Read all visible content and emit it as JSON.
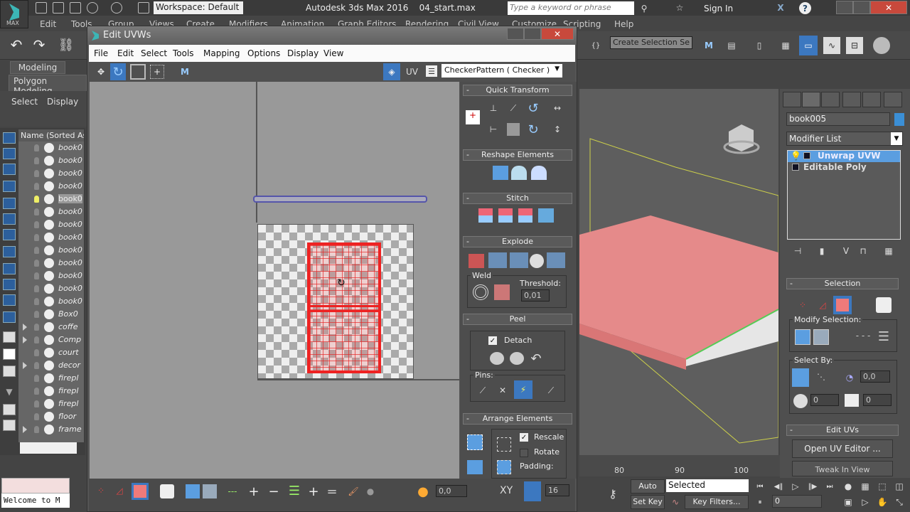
{
  "app": {
    "logo_text": "MAX",
    "workspace": "Workspace: Default",
    "title": "Autodesk 3ds Max 2016",
    "file": "04_start.max",
    "search_placeholder": "Type a keyword or phrase",
    "sign_in": "Sign In",
    "menus": [
      "Edit",
      "Tools",
      "Group",
      "Views",
      "Create",
      "Modifiers",
      "Animation",
      "Graph Editors",
      "Rendering",
      "Civil View",
      "Customize",
      "Scripting",
      "Help"
    ],
    "selection_set": "Create Selection Se"
  },
  "ribbon": {
    "tabs": [
      "Modeling",
      "Polygon Modeling"
    ],
    "sub": [
      "Select",
      "Display"
    ]
  },
  "explorer": {
    "header": "Name (Sorted Asc",
    "rows": [
      {
        "name": "book0",
        "expand": false,
        "light": false
      },
      {
        "name": "book0",
        "expand": false,
        "light": false
      },
      {
        "name": "book0",
        "expand": false,
        "light": false
      },
      {
        "name": "book0",
        "expand": false,
        "light": false
      },
      {
        "name": "book0",
        "expand": false,
        "light": true,
        "selected": true
      },
      {
        "name": "book0",
        "expand": false,
        "light": false
      },
      {
        "name": "book0",
        "expand": false,
        "light": false
      },
      {
        "name": "book0",
        "expand": false,
        "light": false
      },
      {
        "name": "book0",
        "expand": false,
        "light": false
      },
      {
        "name": "book0",
        "expand": false,
        "light": false
      },
      {
        "name": "book0",
        "expand": false,
        "light": false
      },
      {
        "name": "book0",
        "expand": false,
        "light": false
      },
      {
        "name": "book0",
        "expand": false,
        "light": false
      },
      {
        "name": "Box0",
        "expand": false,
        "light": false
      },
      {
        "name": "coffe",
        "expand": true,
        "light": false
      },
      {
        "name": "Comp",
        "expand": true,
        "light": false
      },
      {
        "name": "court",
        "expand": false,
        "light": false
      },
      {
        "name": "decor",
        "expand": true,
        "light": false
      },
      {
        "name": "firepl",
        "expand": false,
        "light": false
      },
      {
        "name": "firepl",
        "expand": false,
        "light": false
      },
      {
        "name": "firepl",
        "expand": false,
        "light": false
      },
      {
        "name": "floor",
        "expand": false,
        "light": false
      },
      {
        "name": "frame",
        "expand": true,
        "light": false
      }
    ],
    "welcome": "Welcome to M"
  },
  "uvw": {
    "title": "Edit UVWs",
    "menus": [
      "File",
      "Edit",
      "Select",
      "Tools",
      "Mapping",
      "Options",
      "Display",
      "View"
    ],
    "uv_label": "UV",
    "texture": "CheckerPattern  ( Checker )",
    "rollouts": {
      "quick_transform": "Quick Transform",
      "reshape": "Reshape Elements",
      "stitch": "Stitch",
      "explode": "Explode",
      "weld": "Weld",
      "threshold_label": "Threshold:",
      "threshold": "0,01",
      "peel": "Peel",
      "detach": "Detach",
      "detach_checked": true,
      "pins": "Pins:",
      "arrange": "Arrange Elements",
      "rescale": "Rescale",
      "rescale_checked": true,
      "rotate": "Rotate",
      "rotate_checked": false,
      "padding": "Padding:"
    },
    "bottom": {
      "soft_value": "0,0",
      "xy": "XY",
      "grid_value": "16"
    }
  },
  "command_panel": {
    "object_name": "book005",
    "object_color": "#3b8fd6",
    "modifier_list": "Modifier List",
    "stack": [
      "Unwrap UVW",
      "Editable Poly"
    ],
    "selection": "Selection",
    "modify_selection": "Modify Selection:",
    "select_by": "Select By:",
    "angle": "0,0",
    "spin1": "0",
    "spin2": "0",
    "edit_uvs": "Edit UVs",
    "open_uv_editor": "Open UV Editor ...",
    "tweak": "Tweak In View"
  },
  "timeline": {
    "ticks": [
      "80",
      "90",
      "100"
    ]
  },
  "anim": {
    "auto_key": "Auto Key",
    "set_key": "Set Key",
    "selected": "Selected",
    "key_filters": "Key Filters...",
    "frame": "0"
  }
}
